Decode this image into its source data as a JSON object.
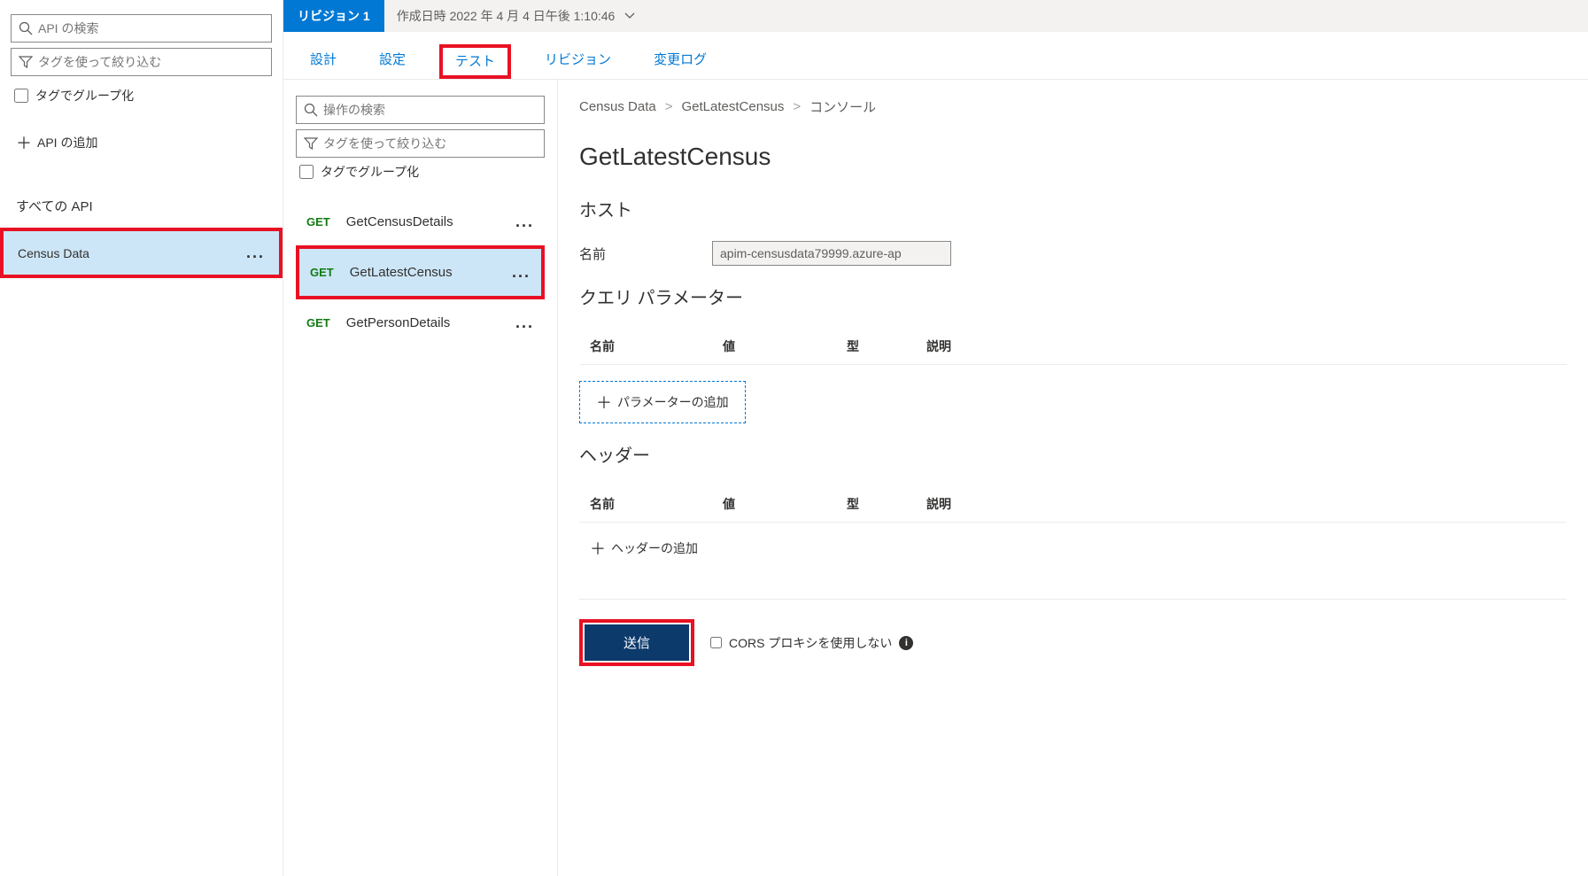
{
  "sidebar": {
    "search_placeholder": "API の検索",
    "filter_placeholder": "タグを使って絞り込む",
    "group_by_tag": "タグでグループ化",
    "add_api": "API の追加",
    "all_apis": "すべての API",
    "items": [
      {
        "label": "Census Data"
      }
    ]
  },
  "revision": {
    "tag": "リビジョン 1",
    "created": "作成日時 2022 年 4 月 4 日午後 1:10:46"
  },
  "tabs": {
    "design": "設計",
    "settings": "設定",
    "test": "テスト",
    "revisions": "リビジョン",
    "changelog": "変更ログ"
  },
  "operations": {
    "search_placeholder": "操作の検索",
    "filter_placeholder": "タグを使って絞り込む",
    "group_by_tag": "タグでグループ化",
    "items": [
      {
        "method": "GET",
        "name": "GetCensusDetails"
      },
      {
        "method": "GET",
        "name": "GetLatestCensus"
      },
      {
        "method": "GET",
        "name": "GetPersonDetails"
      }
    ]
  },
  "breadcrumb": {
    "api": "Census Data",
    "op": "GetLatestCensus",
    "leaf": "コンソール"
  },
  "details": {
    "title": "GetLatestCensus",
    "host_section": "ホスト",
    "name_label": "名前",
    "name_value": "apim-censusdata79999.azure-ap",
    "query_section": "クエリ パラメーター",
    "header_section": "ヘッダー",
    "columns": {
      "name": "名前",
      "value": "値",
      "type": "型",
      "desc": "説明"
    },
    "add_param": "パラメーターの追加",
    "add_header": "ヘッダーの追加",
    "send": "送信",
    "cors_label": "CORS プロキシを使用しない"
  }
}
